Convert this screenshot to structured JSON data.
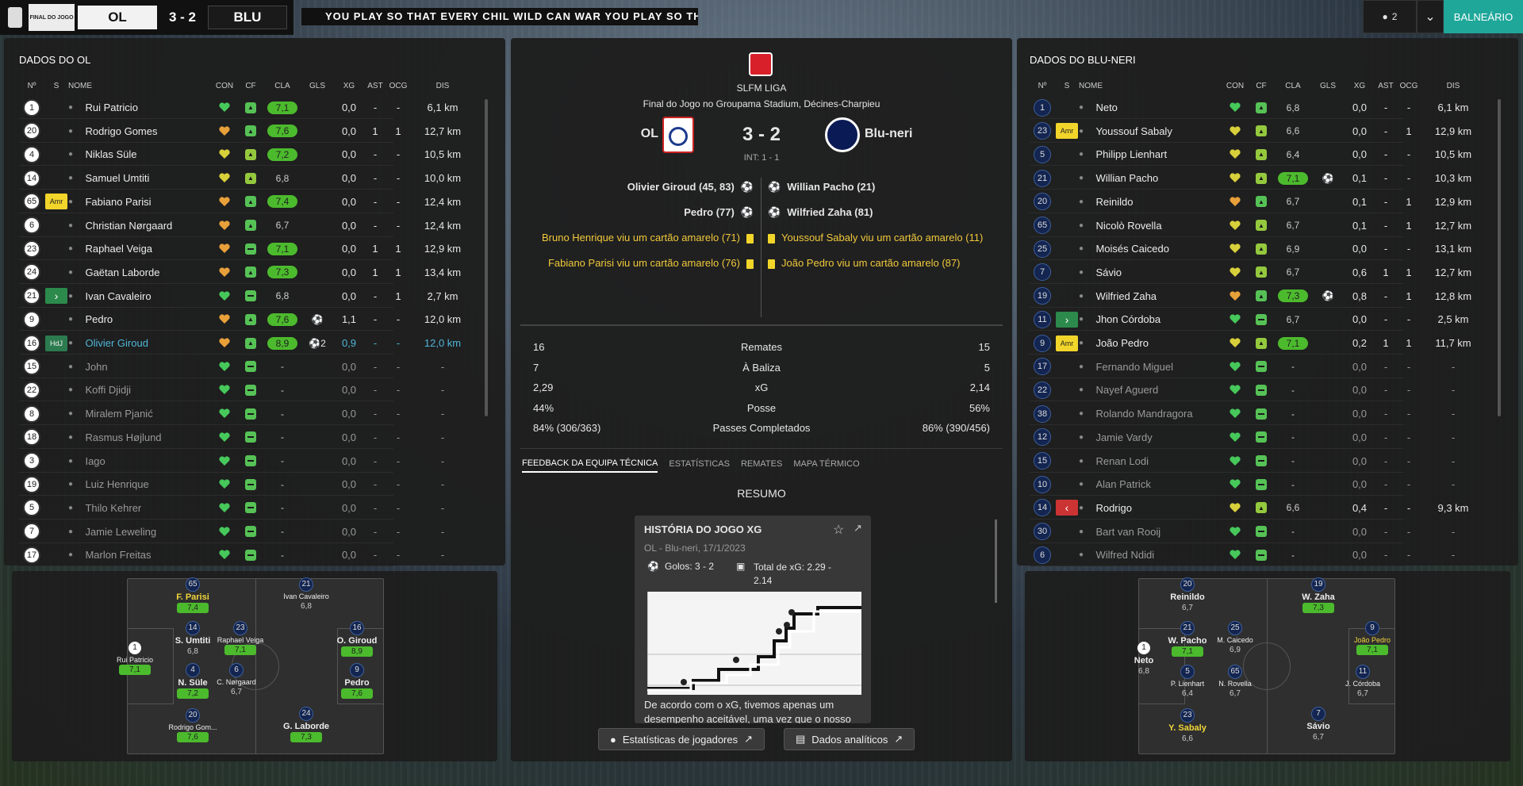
{
  "header": {
    "competition_badge": "FINAL DO JOGO",
    "home": "OL",
    "score": "3 - 2",
    "away": "BLU",
    "banner": "YOU PLAY SO THAT EVERY CHIL  WILD CAN  WAR  YOU PLAY SO TH",
    "users": "2",
    "balneario": "BALNEÁRIO"
  },
  "left": {
    "title": "DADOS DO OL",
    "cols": [
      "Nº",
      "S",
      "NOME",
      "CON",
      "CF",
      "CLA",
      "GLS",
      "XG",
      "AST",
      "OCG",
      "DIS"
    ],
    "players": [
      {
        "n": "1",
        "tag": "",
        "name": "Rui Patricio",
        "cf": "up",
        "cla": "7,1",
        "g": true,
        "gls": "",
        "xg": "0,0",
        "ast": "-",
        "ocg": "-",
        "dis": "6,1 km"
      },
      {
        "n": "20",
        "tag": "",
        "name": "Rodrigo Gomes",
        "cf": "up",
        "cla": "7,6",
        "g": true,
        "gls": "",
        "xg": "0,0",
        "ast": "1",
        "ocg": "1",
        "dis": "12,7 km",
        "h": "o"
      },
      {
        "n": "4",
        "tag": "",
        "name": "Niklas Süle",
        "cf": "up",
        "cla": "7,2",
        "g": true,
        "gls": "",
        "xg": "0,0",
        "ast": "-",
        "ocg": "-",
        "dis": "10,5 km",
        "h": "y"
      },
      {
        "n": "14",
        "tag": "",
        "name": "Samuel Umtiti",
        "cf": "up",
        "cla": "6,8",
        "g": false,
        "gls": "",
        "xg": "0,0",
        "ast": "-",
        "ocg": "-",
        "dis": "10,0 km",
        "h": "y"
      },
      {
        "n": "65",
        "tag": "Amr",
        "name": "Fabiano Parisi",
        "cf": "up",
        "cla": "7,4",
        "g": true,
        "gls": "",
        "xg": "0,0",
        "ast": "-",
        "ocg": "-",
        "dis": "12,4 km",
        "h": "o"
      },
      {
        "n": "6",
        "tag": "",
        "name": "Christian Nørgaard",
        "cf": "up",
        "cla": "6,7",
        "g": false,
        "gls": "",
        "xg": "0,0",
        "ast": "-",
        "ocg": "-",
        "dis": "12,4 km",
        "h": "o"
      },
      {
        "n": "23",
        "tag": "",
        "name": "Raphael Veiga",
        "cf": "dash",
        "cla": "7,1",
        "g": true,
        "gls": "",
        "xg": "0,0",
        "ast": "1",
        "ocg": "1",
        "dis": "12,9 km",
        "h": "o"
      },
      {
        "n": "24",
        "tag": "",
        "name": "Gaëtan Laborde",
        "cf": "up",
        "cla": "7,3",
        "g": true,
        "gls": "",
        "xg": "0,0",
        "ast": "1",
        "ocg": "1",
        "dis": "13,4 km",
        "h": "o"
      },
      {
        "n": "21",
        "tag": "sub",
        "name": "Ivan Cavaleiro",
        "cf": "dash",
        "cla": "6,8",
        "g": false,
        "gls": "",
        "xg": "0,0",
        "ast": "-",
        "ocg": "1",
        "dis": "2,7 km"
      },
      {
        "n": "9",
        "tag": "",
        "name": "Pedro",
        "cf": "up",
        "cla": "7,6",
        "g": true,
        "gls": "⚽",
        "xg": "1,1",
        "ast": "-",
        "ocg": "-",
        "dis": "12,0 km",
        "h": "o"
      },
      {
        "n": "16",
        "tag": "HdJ",
        "name": "Olivier Giroud",
        "cf": "up",
        "cla": "8,9",
        "g": true,
        "gls": "⚽2",
        "xg": "0,9",
        "ast": "-",
        "ocg": "-",
        "dis": "12,0 km",
        "h": "o",
        "hl": true
      },
      {
        "n": "15",
        "tag": "",
        "name": "John",
        "cf": "dash",
        "cla": "-",
        "g": false,
        "gls": "",
        "xg": "0,0",
        "ast": "-",
        "ocg": "-",
        "dis": "-",
        "d": true
      },
      {
        "n": "22",
        "tag": "",
        "name": "Koffi Djidji",
        "cf": "dash",
        "cla": "-",
        "g": false,
        "gls": "",
        "xg": "0,0",
        "ast": "-",
        "ocg": "-",
        "dis": "-",
        "d": true
      },
      {
        "n": "8",
        "tag": "",
        "name": "Miralem Pjanić",
        "cf": "dash",
        "cla": "-",
        "g": false,
        "gls": "",
        "xg": "0,0",
        "ast": "-",
        "ocg": "-",
        "dis": "-",
        "d": true
      },
      {
        "n": "18",
        "tag": "",
        "name": "Rasmus Højlund",
        "cf": "dash",
        "cla": "-",
        "g": false,
        "gls": "",
        "xg": "0,0",
        "ast": "-",
        "ocg": "-",
        "dis": "-",
        "d": true
      },
      {
        "n": "3",
        "tag": "",
        "name": "Iago",
        "cf": "dash",
        "cla": "-",
        "g": false,
        "gls": "",
        "xg": "0,0",
        "ast": "-",
        "ocg": "-",
        "dis": "-",
        "d": true
      },
      {
        "n": "19",
        "tag": "",
        "name": "Luiz Henrique",
        "cf": "dash",
        "cla": "-",
        "g": false,
        "gls": "",
        "xg": "0,0",
        "ast": "-",
        "ocg": "-",
        "dis": "-",
        "d": true
      },
      {
        "n": "5",
        "tag": "",
        "name": "Thilo Kehrer",
        "cf": "dash",
        "cla": "-",
        "g": false,
        "gls": "",
        "xg": "0,0",
        "ast": "-",
        "ocg": "-",
        "dis": "-",
        "d": true
      },
      {
        "n": "7",
        "tag": "",
        "name": "Jamie Leweling",
        "cf": "dash",
        "cla": "-",
        "g": false,
        "gls": "",
        "xg": "0,0",
        "ast": "-",
        "ocg": "-",
        "dis": "-",
        "d": true
      },
      {
        "n": "17",
        "tag": "",
        "name": "Marlon Freitas",
        "cf": "dash",
        "cla": "-",
        "g": false,
        "gls": "",
        "xg": "0,0",
        "ast": "-",
        "ocg": "-",
        "dis": "-",
        "d": true
      }
    ]
  },
  "right": {
    "title": "DADOS DO BLU-NERI",
    "cols": [
      "Nº",
      "S",
      "NOME",
      "CON",
      "CF",
      "CLA",
      "GLS",
      "XG",
      "AST",
      "OCG",
      "DIS"
    ],
    "players": [
      {
        "n": "1",
        "tag": "",
        "name": "Neto",
        "cf": "up",
        "cla": "6,8",
        "g": false,
        "gls": "",
        "xg": "0,0",
        "ast": "-",
        "ocg": "-",
        "dis": "6,1 km"
      },
      {
        "n": "23",
        "tag": "Amr",
        "name": "Youssouf Sabaly",
        "cf": "up",
        "cla": "6,6",
        "g": false,
        "gls": "",
        "xg": "0,0",
        "ast": "-",
        "ocg": "1",
        "dis": "12,9 km",
        "h": "y"
      },
      {
        "n": "5",
        "tag": "",
        "name": "Philipp Lienhart",
        "cf": "up",
        "cla": "6,4",
        "g": false,
        "gls": "",
        "xg": "0,0",
        "ast": "-",
        "ocg": "-",
        "dis": "10,5 km",
        "h": "y"
      },
      {
        "n": "21",
        "tag": "",
        "name": "Willian Pacho",
        "cf": "up",
        "cla": "7,1",
        "g": true,
        "gls": "⚽",
        "xg": "0,1",
        "ast": "-",
        "ocg": "-",
        "dis": "10,3 km",
        "h": "y"
      },
      {
        "n": "20",
        "tag": "",
        "name": "Reinildo",
        "cf": "up",
        "cla": "6,7",
        "g": false,
        "gls": "",
        "xg": "0,1",
        "ast": "-",
        "ocg": "1",
        "dis": "12,9 km",
        "h": "o"
      },
      {
        "n": "65",
        "tag": "",
        "name": "Nicolò Rovella",
        "cf": "up",
        "cla": "6,7",
        "g": false,
        "gls": "",
        "xg": "0,1",
        "ast": "-",
        "ocg": "1",
        "dis": "12,7 km",
        "h": "y"
      },
      {
        "n": "25",
        "tag": "",
        "name": "Moisés Caicedo",
        "cf": "up",
        "cla": "6,9",
        "g": false,
        "gls": "",
        "xg": "0,0",
        "ast": "-",
        "ocg": "-",
        "dis": "13,1 km",
        "h": "y"
      },
      {
        "n": "7",
        "tag": "",
        "name": "Sávio",
        "cf": "up",
        "cla": "6,7",
        "g": false,
        "gls": "",
        "xg": "0,6",
        "ast": "1",
        "ocg": "1",
        "dis": "12,7 km",
        "h": "y"
      },
      {
        "n": "19",
        "tag": "",
        "name": "Wilfried Zaha",
        "cf": "up",
        "cla": "7,3",
        "g": true,
        "gls": "⚽",
        "xg": "0,8",
        "ast": "-",
        "ocg": "1",
        "dis": "12,8 km",
        "h": "o"
      },
      {
        "n": "11",
        "tag": "sub",
        "name": "Jhon Córdoba",
        "cf": "dash",
        "cla": "6,7",
        "g": false,
        "gls": "",
        "xg": "0,0",
        "ast": "-",
        "ocg": "-",
        "dis": "2,5 km"
      },
      {
        "n": "9",
        "tag": "Amr",
        "name": "João Pedro",
        "cf": "up",
        "cla": "7,1",
        "g": true,
        "gls": "",
        "xg": "0,2",
        "ast": "1",
        "ocg": "1",
        "dis": "11,7 km",
        "h": "y"
      },
      {
        "n": "17",
        "tag": "",
        "name": "Fernando Miguel",
        "cf": "dash",
        "cla": "-",
        "g": false,
        "gls": "",
        "xg": "0,0",
        "ast": "-",
        "ocg": "-",
        "dis": "-",
        "d": true
      },
      {
        "n": "22",
        "tag": "",
        "name": "Nayef Aguerd",
        "cf": "dash",
        "cla": "-",
        "g": false,
        "gls": "",
        "xg": "0,0",
        "ast": "-",
        "ocg": "-",
        "dis": "-",
        "d": true
      },
      {
        "n": "38",
        "tag": "",
        "name": "Rolando Mandragora",
        "cf": "dash",
        "cla": "-",
        "g": false,
        "gls": "",
        "xg": "0,0",
        "ast": "-",
        "ocg": "-",
        "dis": "-",
        "d": true
      },
      {
        "n": "12",
        "tag": "",
        "name": "Jamie Vardy",
        "cf": "dash",
        "cla": "-",
        "g": false,
        "gls": "",
        "xg": "0,0",
        "ast": "-",
        "ocg": "-",
        "dis": "-",
        "d": true
      },
      {
        "n": "15",
        "tag": "",
        "name": "Renan Lodi",
        "cf": "dash",
        "cla": "-",
        "g": false,
        "gls": "",
        "xg": "0,0",
        "ast": "-",
        "ocg": "-",
        "dis": "-",
        "d": true
      },
      {
        "n": "10",
        "tag": "",
        "name": "Alan Patrick",
        "cf": "dash",
        "cla": "-",
        "g": false,
        "gls": "",
        "xg": "0,0",
        "ast": "-",
        "ocg": "-",
        "dis": "-",
        "d": true
      },
      {
        "n": "14",
        "tag": "out",
        "name": "Rodrigo",
        "cf": "up",
        "cla": "6,6",
        "g": false,
        "gls": "",
        "xg": "0,4",
        "ast": "-",
        "ocg": "-",
        "dis": "9,3 km",
        "h": "y"
      },
      {
        "n": "30",
        "tag": "",
        "name": "Bart van Rooij",
        "cf": "dash",
        "cla": "-",
        "g": false,
        "gls": "",
        "xg": "0,0",
        "ast": "-",
        "ocg": "-",
        "dis": "-",
        "d": true
      },
      {
        "n": "6",
        "tag": "",
        "name": "Wilfred Ndidi",
        "cf": "dash",
        "cla": "-",
        "g": false,
        "gls": "",
        "xg": "0,0",
        "ast": "-",
        "ocg": "-",
        "dis": "-",
        "d": true
      }
    ]
  },
  "match": {
    "league": "SLFM LIGA",
    "venue": "Final do Jogo no Groupama Stadium, Décines-Charpieu",
    "home": "OL",
    "away": "Blu-neri",
    "score": "3 - 2",
    "ht": "INT: 1 - 1",
    "home_events": [
      {
        "t": "Olivier Giroud (45, 83)",
        "k": "goal"
      },
      {
        "t": "Pedro (77)",
        "k": "goal"
      },
      {
        "t": "Bruno Henrique viu um cartão amarelo (71)",
        "k": "card"
      },
      {
        "t": "Fabiano Parisi viu um cartão amarelo (76)",
        "k": "card"
      }
    ],
    "away_events": [
      {
        "t": "Willian Pacho (21)",
        "k": "goal"
      },
      {
        "t": "Wilfried Zaha (81)",
        "k": "goal"
      },
      {
        "t": "Youssouf Sabaly viu um cartão amarelo (11)",
        "k": "card"
      },
      {
        "t": "João Pedro viu um cartão amarelo (87)",
        "k": "card"
      }
    ]
  },
  "stats": [
    {
      "h": "16",
      "l": "Remates",
      "a": "15"
    },
    {
      "h": "7",
      "l": "À Baliza",
      "a": "5"
    },
    {
      "h": "2,29",
      "l": "xG",
      "a": "2,14"
    },
    {
      "h": "44%",
      "l": "Posse",
      "a": "56%"
    },
    {
      "h": "84% (306/363)",
      "l": "Passes Completados",
      "a": "86% (390/456)"
    }
  ],
  "tabs": [
    "FEEDBACK DA EQUIPA TÉCNICA",
    "ESTATÍSTICAS",
    "REMATES",
    "MAPA TÉRMICO"
  ],
  "summary": {
    "title": "RESUMO",
    "card_title": "HISTÓRIA DO JOGO XG",
    "card_sub": "OL - Blu-neri, 17/1/2023",
    "goals": "Golos: 3 - 2",
    "xg_total": "Total de xG: 2.29 - 2.14",
    "text": "De acordo com o xG, tivemos apenas um desempenho aceitável, uma vez que o nosso"
  },
  "buttons": {
    "players": "Estatísticas de jogadores",
    "analytics": "Dados analíticos"
  },
  "home_formation": [
    {
      "n": "1",
      "name": "Rui Patricio",
      "r": "7,1",
      "g": true,
      "w": true,
      "small": true
    },
    {
      "n": "65",
      "name": "F. Parisi",
      "r": "7,4",
      "g": true,
      "y": true
    },
    {
      "n": "14",
      "name": "S. Umtiti",
      "r": "6,8",
      "g": false
    },
    {
      "n": "4",
      "name": "N. Süle",
      "r": "7,2",
      "g": true
    },
    {
      "n": "20",
      "name": "Rodrigo Gom...",
      "r": "7,6",
      "g": true,
      "small": true
    },
    {
      "n": "23",
      "name": "Raphael Veiga",
      "r": "7,1",
      "g": true,
      "small": true
    },
    {
      "n": "6",
      "name": "C. Nørgaard",
      "r": "6,7",
      "g": false,
      "small": true
    },
    {
      "n": "21",
      "name": "Ivan Cavaleiro",
      "r": "6,8",
      "g": false,
      "small": true
    },
    {
      "n": "16",
      "name": "O. Giroud",
      "r": "8,9",
      "g": true
    },
    {
      "n": "9",
      "name": "Pedro",
      "r": "7,6",
      "g": true
    },
    {
      "n": "24",
      "name": "G. Laborde",
      "r": "7,3",
      "g": true
    }
  ],
  "away_formation": [
    {
      "n": "1",
      "name": "Neto",
      "r": "6,8",
      "g": false,
      "w": true
    },
    {
      "n": "20",
      "name": "Reinildo",
      "r": "6,7",
      "g": false
    },
    {
      "n": "21",
      "name": "W. Pacho",
      "r": "7,1",
      "g": true
    },
    {
      "n": "5",
      "name": "P. Lienhart",
      "r": "6,4",
      "g": false,
      "small": true
    },
    {
      "n": "23",
      "name": "Y. Sabaly",
      "r": "6,6",
      "g": false,
      "y": true
    },
    {
      "n": "25",
      "name": "M. Caicedo",
      "r": "6,9",
      "g": false,
      "small": true
    },
    {
      "n": "65",
      "name": "N. Rovella",
      "r": "6,7",
      "g": false,
      "small": true
    },
    {
      "n": "7",
      "name": "Sávio",
      "r": "6,7",
      "g": false
    },
    {
      "n": "19",
      "name": "W. Zaha",
      "r": "7,3",
      "g": true
    },
    {
      "n": "9",
      "name": "João Pedro",
      "r": "7,1",
      "g": true,
      "y": true,
      "small": true
    },
    {
      "n": "11",
      "name": "J. Córdoba",
      "r": "6,7",
      "g": false,
      "small": true
    }
  ]
}
